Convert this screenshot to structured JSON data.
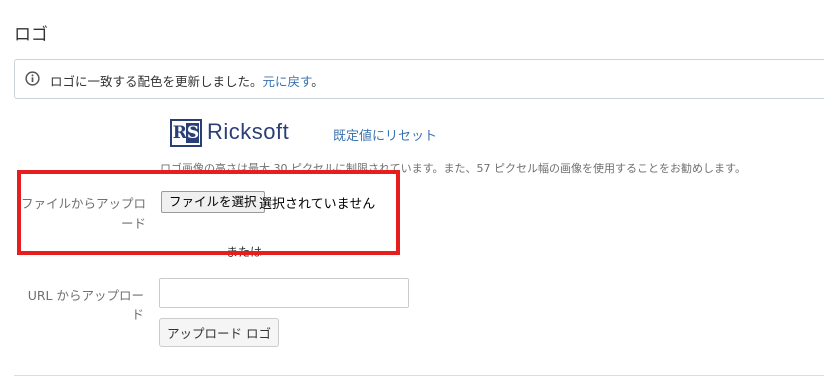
{
  "page": {
    "title": "ロゴ"
  },
  "info": {
    "message": "ロゴに一致する配色を更新しました。",
    "link": "元に戻す",
    "suffix": "。"
  },
  "logo": {
    "mark": "RS",
    "mark_r": "R",
    "mark_s": "S",
    "word": "Ricksoft",
    "brand_color": "#2a3f78"
  },
  "reset_link": "既定値にリセット",
  "hint": "ロゴ画像の高さは最大 30 ピクセルに制限されています。また、57 ピクセル幅の画像を使用することをお勧めします。",
  "file_upload": {
    "label": "ファイルからアップロード",
    "button": "ファイルを選択",
    "status": "選択されていません"
  },
  "or_text": "または",
  "url_upload": {
    "label": "URL からアップロード",
    "value": "",
    "button": "アップロード ロゴ"
  },
  "colors": {
    "link": "#3b73af",
    "highlight": "#e61e1e"
  }
}
